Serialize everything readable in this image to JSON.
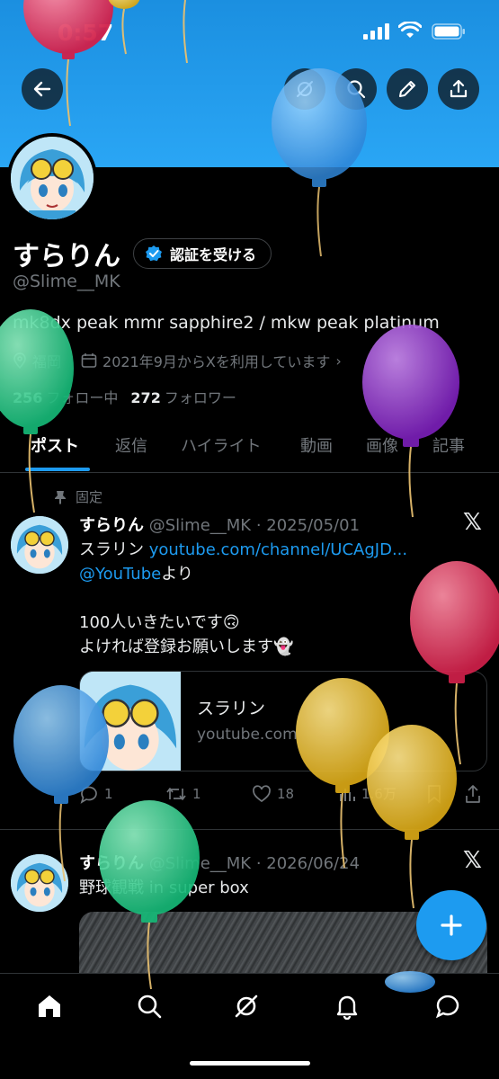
{
  "status_bar": {
    "time": "0:57"
  },
  "profile": {
    "display_name": "すらりん",
    "verify_label": "認証を受ける",
    "handle": "@Slime__MK",
    "bio": "mk8dx peak mmr sapphire2 / mkw peak platinum",
    "location": "福岡",
    "joined": "2021年9月からXを利用しています",
    "following_count": "256",
    "following_label": "フォロー中",
    "followers_count": "272",
    "followers_label": "フォロワー"
  },
  "tabs": [
    "ポスト",
    "返信",
    "ハイライト",
    "動画",
    "画像",
    "記事"
  ],
  "pinned_label": "固定",
  "posts": [
    {
      "name": "すらりん",
      "meta": "@Slime__MK · 2025/05/01",
      "line1_prefix": "スラリン ",
      "line1_link": "youtube.com/channel/UCAgJD...",
      "line2_link": "@YouTube",
      "line2_suffix": "より",
      "line3": "100人いきたいです🙃",
      "line4": "よければ登録お願いします👻",
      "card_title": "スラリン",
      "card_domain": "youtube.com",
      "replies": "1",
      "reposts": "1",
      "likes": "18",
      "views": "1.6万"
    },
    {
      "name": "すらりん",
      "meta": "@Slime__MK · 2026/06/24",
      "text": "野球観戦 in super box"
    }
  ],
  "colors": {
    "accent": "#1d9bf0",
    "banner": "#2aa6f5",
    "background": "#000000"
  }
}
